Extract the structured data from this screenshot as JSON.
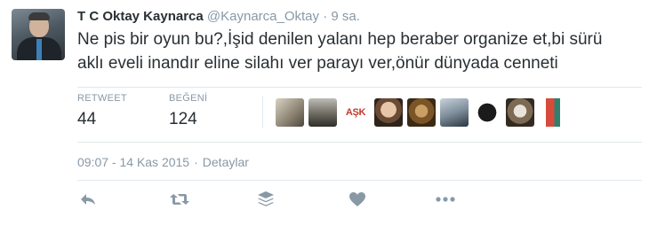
{
  "tweet": {
    "display_name": "T C Oktay Kaynarca",
    "handle": "@Kaynarca_Oktay",
    "separator": "·",
    "time_ago": "9 sa.",
    "text_line1": "Ne pis bir oyun bu?,İşid denilen yalanı hep beraber organize et,bi sürü",
    "text_line2": "aklı eveli inandır eline silahı ver parayı ver,önür dünyada cenneti"
  },
  "stats": {
    "retweets_label": "RETWEET",
    "retweets_value": "44",
    "likes_label": "BEĞENİ",
    "likes_value": "124"
  },
  "likers": {
    "ask_label": "AŞK"
  },
  "meta": {
    "time": "09:07 - 14 Kas 2015",
    "dot": "·",
    "details_link": "Detaylar"
  },
  "actions": {
    "icons": [
      "reply-icon",
      "retweet-icon",
      "buffer-icon",
      "like-icon",
      "more-icon"
    ],
    "icon_color": "#8899a6"
  },
  "colors": {
    "text": "#292f33",
    "muted": "#8899a6",
    "border": "#e1e8ed"
  }
}
